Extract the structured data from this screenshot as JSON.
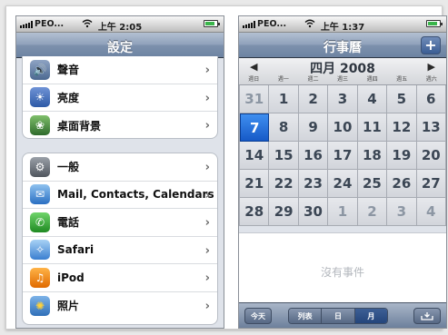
{
  "left_phone": {
    "status": {
      "carrier": "PEO...",
      "time": "上午 2:05"
    },
    "nav_title": "設定",
    "group1": [
      {
        "label": "聲音",
        "icon": "speaker-icon"
      },
      {
        "label": "亮度",
        "icon": "brightness-icon"
      },
      {
        "label": "桌面背景",
        "icon": "wallpaper-icon"
      }
    ],
    "group2": [
      {
        "label": "一般",
        "icon": "gear-icon"
      },
      {
        "label": "Mail, Contacts, Calendars",
        "icon": "mail-icon"
      },
      {
        "label": "電話",
        "icon": "phone-icon"
      },
      {
        "label": "Safari",
        "icon": "safari-compass-icon"
      },
      {
        "label": "iPod",
        "icon": "ipod-icon"
      },
      {
        "label": "照片",
        "icon": "photos-sunflower-icon"
      }
    ],
    "chevron": "›"
  },
  "right_phone": {
    "status": {
      "carrier": "PEO...",
      "time": "上午 1:37"
    },
    "nav_title": "行事曆",
    "add_label": "+",
    "month_label": "四月 2008",
    "prev_label": "◀",
    "next_label": "▶",
    "weekdays": [
      "週日",
      "週一",
      "週二",
      "週三",
      "週四",
      "週五",
      "週六"
    ],
    "days": [
      {
        "n": "31",
        "dim": true
      },
      {
        "n": "1"
      },
      {
        "n": "2"
      },
      {
        "n": "3"
      },
      {
        "n": "4"
      },
      {
        "n": "5"
      },
      {
        "n": "6"
      },
      {
        "n": "7",
        "sel": true
      },
      {
        "n": "8"
      },
      {
        "n": "9"
      },
      {
        "n": "10"
      },
      {
        "n": "11"
      },
      {
        "n": "12"
      },
      {
        "n": "13"
      },
      {
        "n": "14"
      },
      {
        "n": "15"
      },
      {
        "n": "16"
      },
      {
        "n": "17"
      },
      {
        "n": "18"
      },
      {
        "n": "19"
      },
      {
        "n": "20"
      },
      {
        "n": "21"
      },
      {
        "n": "22"
      },
      {
        "n": "23"
      },
      {
        "n": "24"
      },
      {
        "n": "25"
      },
      {
        "n": "26"
      },
      {
        "n": "27"
      },
      {
        "n": "28"
      },
      {
        "n": "29"
      },
      {
        "n": "30"
      },
      {
        "n": "1",
        "dim": true
      },
      {
        "n": "2",
        "dim": true
      },
      {
        "n": "3",
        "dim": true
      },
      {
        "n": "4",
        "dim": true
      }
    ],
    "no_events": "沒有事件",
    "toolbar": {
      "today": "今天",
      "list": "列表",
      "day": "日",
      "month": "月"
    }
  }
}
